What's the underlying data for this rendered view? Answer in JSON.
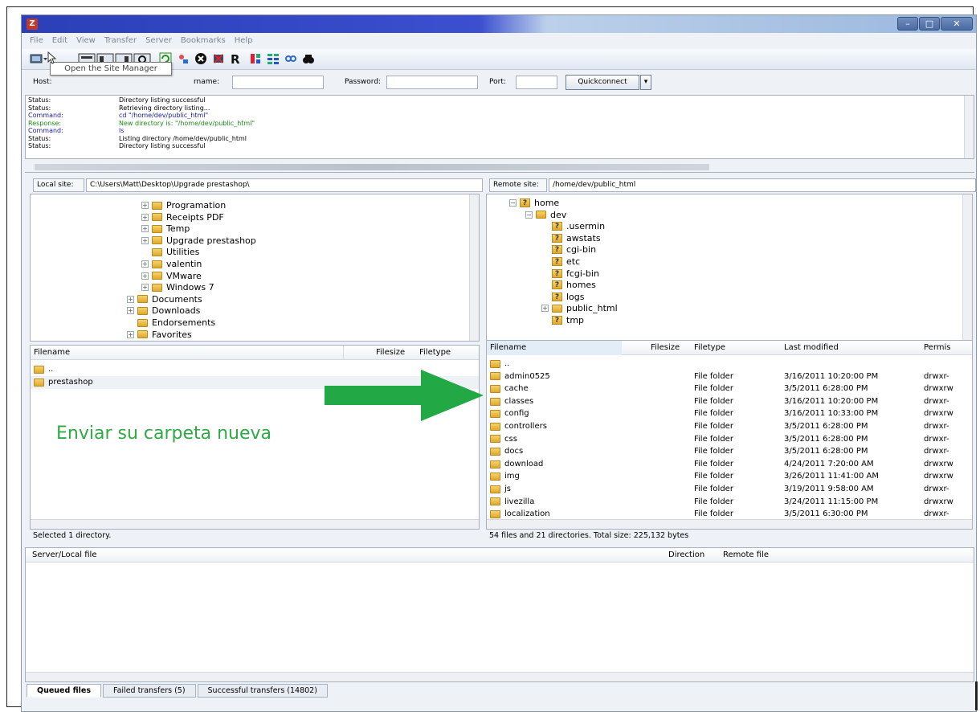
{
  "window": {
    "app_icon": "Z",
    "min_label": "–",
    "max_label": "□",
    "close_label": "✕"
  },
  "menu": [
    "File",
    "Edit",
    "View",
    "Transfer",
    "Server",
    "Bookmarks",
    "Help"
  ],
  "tooltip": "Open the Site Manager",
  "quickconnect": {
    "host_label": "Host:",
    "username_label": "rname:",
    "password_label": "Password:",
    "port_label": "Port:",
    "button_label": "Quickconnect",
    "dropdown_label": "▾"
  },
  "log": [
    {
      "type": "Status:",
      "msg": "Directory listing successful",
      "color": "#000000"
    },
    {
      "type": "Status:",
      "msg": "Retrieving directory listing...",
      "color": "#000000"
    },
    {
      "type": "Command:",
      "msg": "cd \"/home/dev/public_html\"",
      "color": "#1a1aa6"
    },
    {
      "type": "Response:",
      "msg": "New directory is: \"/home/dev/public_html\"",
      "color": "#1a8a1a"
    },
    {
      "type": "Command:",
      "msg": "ls",
      "color": "#1a1aa6"
    },
    {
      "type": "Status:",
      "msg": "Listing directory /home/dev/public_html",
      "color": "#000000"
    },
    {
      "type": "Status:",
      "msg": "Directory listing successful",
      "color": "#000000"
    }
  ],
  "local": {
    "site_label": "Local site:",
    "path": "C:\\Users\\Matt\\Desktop\\Upgrade prestashop\\",
    "tree": [
      {
        "label": "Programation",
        "expand": "+"
      },
      {
        "label": "Receipts PDF",
        "expand": "+"
      },
      {
        "label": "Temp",
        "expand": "+"
      },
      {
        "label": "Upgrade prestashop",
        "expand": "+"
      },
      {
        "label": "Utilities",
        "expand": ""
      },
      {
        "label": "valentin",
        "expand": "+"
      },
      {
        "label": "VMware",
        "expand": "+"
      },
      {
        "label": "Windows 7",
        "expand": "+"
      },
      {
        "label": "Documents",
        "expand": "+"
      },
      {
        "label": "Downloads",
        "expand": "+"
      },
      {
        "label": "Endorsements",
        "expand": ""
      },
      {
        "label": "Favorites",
        "expand": "+"
      }
    ],
    "columns": [
      "Filename",
      "Filesize",
      "Filetype"
    ],
    "files": [
      "..",
      "prestashop"
    ],
    "status": "Selected 1 directory."
  },
  "remote": {
    "site_label": "Remote site:",
    "path": "/home/dev/public_html",
    "tree": [
      {
        "label": "home",
        "expand": "−",
        "q": "?"
      },
      {
        "label": "dev",
        "expand": "−",
        "q": ""
      },
      {
        "label": ".usermin",
        "expand": "",
        "q": "?"
      },
      {
        "label": "awstats",
        "expand": "",
        "q": "?"
      },
      {
        "label": "cgi-bin",
        "expand": "",
        "q": "?"
      },
      {
        "label": "etc",
        "expand": "",
        "q": "?"
      },
      {
        "label": "fcgi-bin",
        "expand": "",
        "q": "?"
      },
      {
        "label": "homes",
        "expand": "",
        "q": "?"
      },
      {
        "label": "logs",
        "expand": "",
        "q": "?"
      },
      {
        "label": "public_html",
        "expand": "+",
        "q": ""
      },
      {
        "label": "tmp",
        "expand": "",
        "q": "?"
      }
    ],
    "columns": [
      "Filename",
      "Filesize",
      "Filetype",
      "Last modified",
      "Permis"
    ],
    "files": [
      {
        "name": "..",
        "type": "",
        "modified": "",
        "perm": ""
      },
      {
        "name": "admin0525",
        "type": "File folder",
        "modified": "3/16/2011 10:20:00 PM",
        "perm": "drwxr-"
      },
      {
        "name": "cache",
        "type": "File folder",
        "modified": "3/5/2011 6:28:00 PM",
        "perm": "drwxrw"
      },
      {
        "name": "classes",
        "type": "File folder",
        "modified": "3/16/2011 10:20:00 PM",
        "perm": "drwxr-"
      },
      {
        "name": "config",
        "type": "File folder",
        "modified": "3/16/2011 10:33:00 PM",
        "perm": "drwxrw"
      },
      {
        "name": "controllers",
        "type": "File folder",
        "modified": "3/5/2011 6:28:00 PM",
        "perm": "drwxr-"
      },
      {
        "name": "css",
        "type": "File folder",
        "modified": "3/5/2011 6:28:00 PM",
        "perm": "drwxr-"
      },
      {
        "name": "docs",
        "type": "File folder",
        "modified": "3/5/2011 6:28:00 PM",
        "perm": "drwxr-"
      },
      {
        "name": "download",
        "type": "File folder",
        "modified": "4/24/2011 7:20:00 AM",
        "perm": "drwxrw"
      },
      {
        "name": "img",
        "type": "File folder",
        "modified": "3/26/2011 11:41:00 AM",
        "perm": "drwxrw"
      },
      {
        "name": "js",
        "type": "File folder",
        "modified": "3/19/2011 9:58:00 AM",
        "perm": "drwxr-"
      },
      {
        "name": "livezilla",
        "type": "File folder",
        "modified": "3/24/2011 11:15:00 PM",
        "perm": "drwxrw"
      },
      {
        "name": "localization",
        "type": "File folder",
        "modified": "3/5/2011 6:30:00 PM",
        "perm": "drwxr-"
      }
    ],
    "status": "54 files and 21 directories. Total size: 225,132 bytes"
  },
  "queue": {
    "columns": [
      "Server/Local file",
      "Direction",
      "Remote file"
    ],
    "tabs": [
      "Queued files",
      "Failed transfers (5)",
      "Successful transfers (14802)"
    ]
  },
  "annotation": "Enviar su carpeta nueva",
  "colors": {
    "annotation": "#2eaa44",
    "arrow": "#22a845",
    "title_bar": "#2b3fb8"
  }
}
